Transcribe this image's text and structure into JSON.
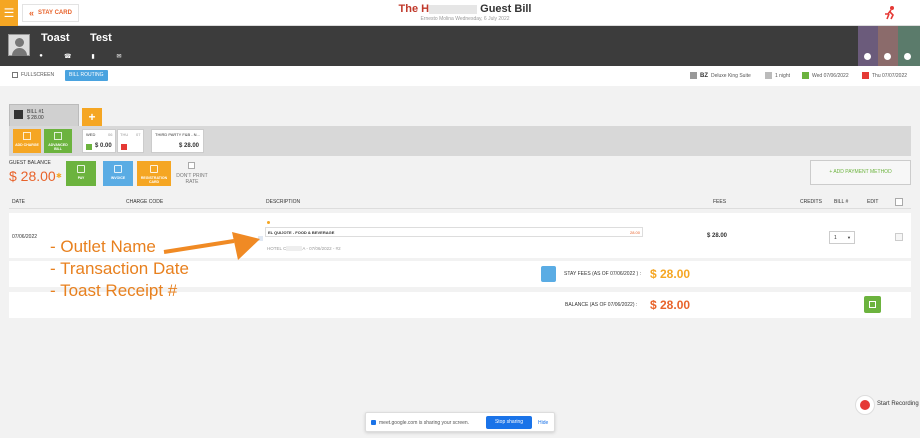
{
  "topbar": {
    "menu_icon": "menu-icon",
    "staycard_label": "STAY CARD",
    "title_prefix": "The H",
    "title_suffix": "Guest Bill",
    "subtitle": "Ernesto Molina    Wednesday, 6 July 2022"
  },
  "guest": {
    "first_name": "Toast",
    "last_name": "Test"
  },
  "toolbar": {
    "fullscreen_label": "FULLSCREEN",
    "billrouting_label": "BILL ROUTING",
    "room_type_code": "BZ",
    "room_type": "Deluxe King Suite",
    "nights": "1 night",
    "arrival": "Wed 07/06/2022",
    "departure": "Thu 07/07/2022"
  },
  "bill": {
    "tab_label": "BILL #1",
    "tab_amount": "$ 28.00",
    "add_label": "+",
    "add_charge": "ADD CHARGE",
    "advanced_bill": "ADVANCED BILL",
    "day1_label": "WED",
    "day1_num": "06",
    "day1_amount": "$ 0.00",
    "day2_label": "THU",
    "day2_num": "07",
    "third_party_label": "THIRD PARTY F&B - N...",
    "third_party_amount": "$ 28.00"
  },
  "balance": {
    "label": "GUEST BALANCE",
    "amount": "$ 28.00",
    "pay": "PAY",
    "invoice": "INVOICE",
    "registration": "REGISTRATION CARD",
    "dont_print": "DON'T PRINT RATE",
    "add_payment": "+ ADD PAYMENT METHOD"
  },
  "table": {
    "headers": {
      "date": "DATE",
      "charge_code": "CHARGE CODE",
      "description": "DESCRIPTION",
      "fees": "FEES",
      "credits": "CREDITS",
      "bill": "BILL #",
      "edit": "EDIT"
    },
    "row": {
      "date": "07/06/2022",
      "outlet": "EL QUIJOTE - FOOD & BEVERAGE",
      "desc_amount": "28.00",
      "sub_prefix": "HOTEL C",
      "sub_suffix": "A - 07/06/2022 - #2",
      "fee": "$ 28.00",
      "bill_no": "1"
    },
    "stay_fees_label": "STAY FEES (AS OF  07/06/2022 ) :",
    "stay_fees_value": "$ 28.00",
    "balance_label": "BALANCE (AS OF  07/06/2022) :",
    "balance_value": "$ 28.00"
  },
  "annotations": [
    "- Outlet Name",
    "- Transaction Date",
    "- Toast Receipt #"
  ],
  "sharebar": {
    "text": "meet.google.com is sharing your screen.",
    "stop": "Stop sharing",
    "hide": "Hide"
  },
  "recording": {
    "label": "Start Recording"
  },
  "colors": {
    "accent_orange": "#f5a623",
    "brand_red": "#e8632b",
    "green": "#6cb33e",
    "blue": "#4aa3df",
    "header_dark": "#3c3c3c"
  }
}
